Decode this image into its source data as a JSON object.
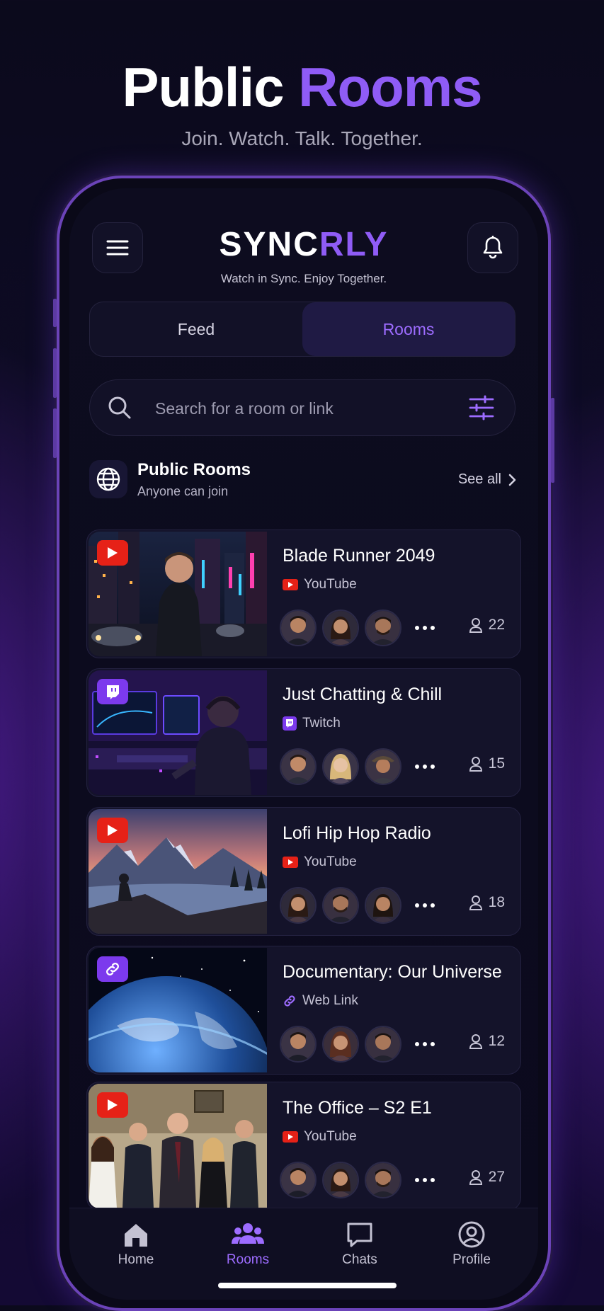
{
  "hero": {
    "title_main": "Public ",
    "title_accent": "Rooms",
    "subtitle": "Join. Watch. Talk. Together."
  },
  "app": {
    "logo_a": "SYNC",
    "logo_b": "RLY",
    "tagline": "Watch in Sync. Enjoy Together."
  },
  "segments": {
    "feed": "Feed",
    "rooms": "Rooms",
    "active": "rooms"
  },
  "search": {
    "placeholder": "Search for a room or link"
  },
  "section": {
    "title": "Public Rooms",
    "subtitle": "Anyone can join",
    "see_all": "See all"
  },
  "rooms": [
    {
      "title": "Blade Runner 2049",
      "source": "YouTube",
      "source_icon": "youtube-icon",
      "viewers": "22"
    },
    {
      "title": "Just Chatting & Chill",
      "source": "Twitch",
      "source_icon": "twitch-icon",
      "viewers": "15"
    },
    {
      "title": "Lofi Hip Hop Radio",
      "source": "YouTube",
      "source_icon": "youtube-icon",
      "viewers": "18"
    },
    {
      "title": "Documentary: Our Universe",
      "source": "Web Link",
      "source_icon": "link-icon",
      "viewers": "12"
    },
    {
      "title": "The Office – S2 E1",
      "source": "YouTube",
      "source_icon": "youtube-icon",
      "viewers": "27"
    }
  ],
  "tabs": [
    {
      "label": "Home",
      "icon": "home-icon"
    },
    {
      "label": "Rooms",
      "icon": "users-icon",
      "active": true
    },
    {
      "label": "Chats",
      "icon": "chat-icon"
    },
    {
      "label": "Profile",
      "icon": "profile-icon"
    }
  ],
  "colors": {
    "accent": "#8f5cf6",
    "youtube": "#e62117",
    "twitch": "#7c3aed",
    "background": "#0b0a1c"
  }
}
